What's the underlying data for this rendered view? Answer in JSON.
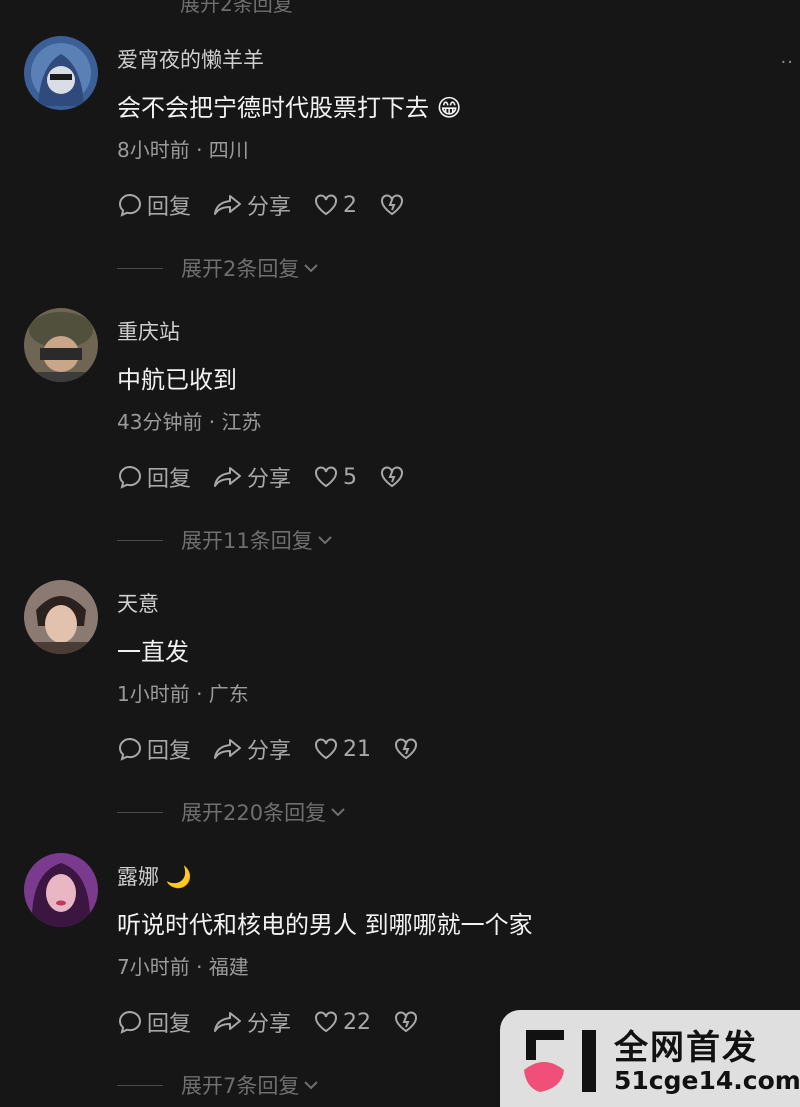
{
  "top_partial_label": "展开2条回复",
  "comments": [
    {
      "username": "爱宵夜的懒羊羊",
      "text": "会不会把宁德时代股票打下去 😁",
      "meta": "8小时前 · 四川",
      "reply_label": "回复",
      "share_label": "分享",
      "likes": "2",
      "expand_label": "展开2条回复"
    },
    {
      "username": "重庆站",
      "text": "中航已收到",
      "meta": "43分钟前 · 江苏",
      "reply_label": "回复",
      "share_label": "分享",
      "likes": "5",
      "expand_label": "展开11条回复"
    },
    {
      "username": "天意",
      "text": "一直发",
      "meta": "1小时前 · 广东",
      "reply_label": "回复",
      "share_label": "分享",
      "likes": "21",
      "expand_label": "展开220条回复"
    },
    {
      "username": "露娜 🌙",
      "text": "听说时代和核电的男人 到哪哪就一个家",
      "meta": "7小时前 · 福建",
      "reply_label": "回复",
      "share_label": "分享",
      "likes": "22",
      "expand_label": "展开7条回复"
    }
  ],
  "icons": {
    "reply": "speech-bubble-icon",
    "share": "share-arrow-icon",
    "like": "heart-icon",
    "dislike": "broken-heart-icon",
    "expand": "chevron-down-icon",
    "more": "more-dots-icon"
  },
  "watermark": {
    "line1": "全网首发",
    "line2": "51cge14.com"
  },
  "colors": {
    "background": "#161616",
    "text_primary": "#f2f2f2",
    "text_secondary": "#9a9a9a",
    "watermark_accent": "#ef4f79"
  }
}
